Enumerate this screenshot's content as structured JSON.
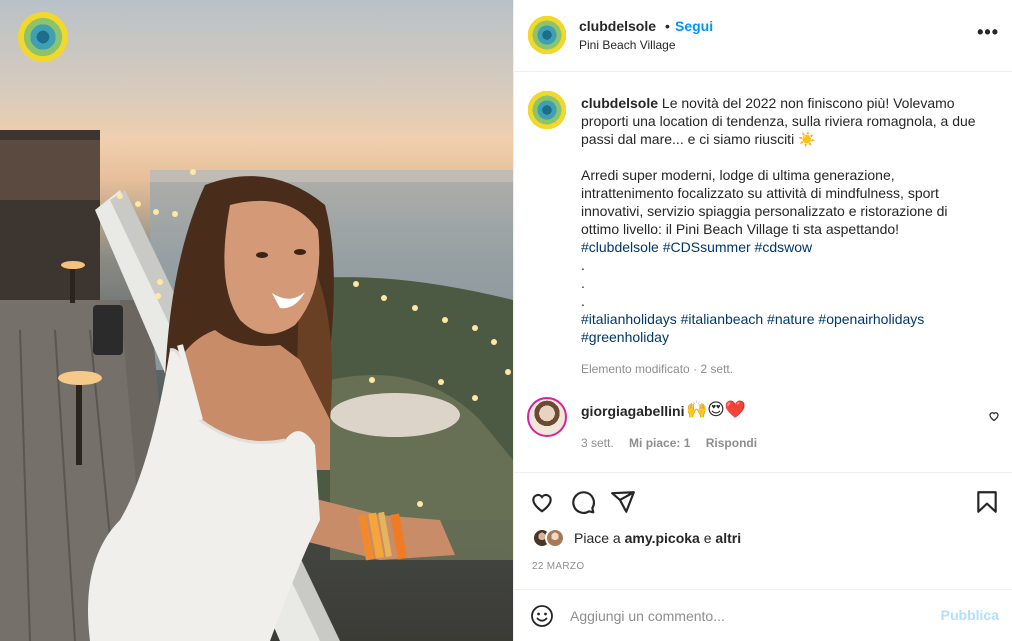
{
  "post": {
    "username": "clubdelsole",
    "follow_label": "Segui",
    "separator": "•",
    "location": "Pini Beach Village",
    "more_label": "•••"
  },
  "caption": {
    "username": "clubdelsole",
    "text_1": " Le novità del 2022 non finiscono più! Volevamo proporti una location di tendenza, sulla riviera romagnola, a due passi dal mare... e ci siamo riusciti ☀️\n\nArredi super moderni, lodge di ultima generazione, intrattenimento focalizzato su attività di mindfulness, sport innovativi, servizio spiaggia personalizzato e ristorazione di ottimo livello: il Pini Beach Village ti sta aspettando!\n",
    "hashtags_1": [
      "#clubdelsole",
      "#CDSsummer",
      "#cdswow"
    ],
    "dots": ".\n.\n.\n",
    "hashtags_2": [
      "#italianholidays",
      "#italianbeach",
      "#nature",
      "#openairholidays",
      "#greenholiday"
    ],
    "edited": "Elemento modificato · 2 sett."
  },
  "comment": {
    "username": "giorgiagabellini",
    "text": "🙌😍❤️",
    "time": "3 sett.",
    "likes": "Mi piace: 1",
    "reply": "Rispondi"
  },
  "likes": {
    "prefix": "Piace a ",
    "user": "amy.picoka",
    "middle": " e ",
    "others": "altri"
  },
  "date": "22 MARZO",
  "add_comment": {
    "placeholder": "Aggiungi un commento...",
    "post_label": "Pubblica"
  },
  "colors": {
    "accent": "#0095f6",
    "hashtag": "#00376b",
    "muted": "#8e8e8e",
    "post_disabled": "#b2dffc"
  },
  "icons": [
    "heart-icon",
    "comment-icon",
    "share-icon",
    "bookmark-icon",
    "emoji-icon",
    "more-icon"
  ]
}
